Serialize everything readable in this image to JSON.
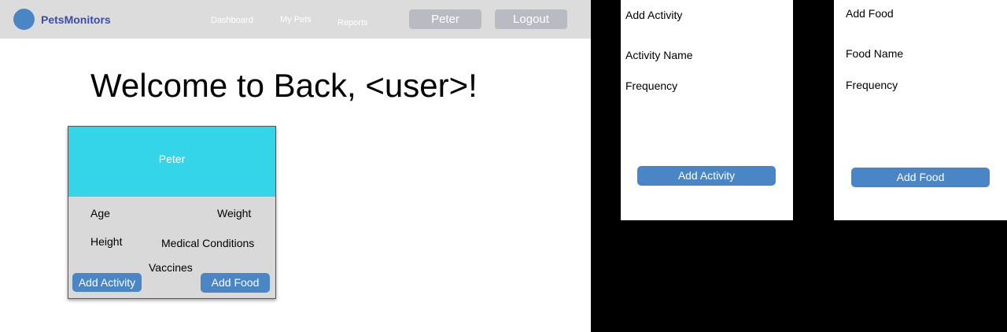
{
  "navbar": {
    "brand": "PetsMonitors",
    "links": [
      "Dashboard",
      "My Pets",
      "Reports"
    ],
    "user_button": "Peter",
    "logout_button": "Logout"
  },
  "main": {
    "welcome": "Welcome to Back, <user>!"
  },
  "pet_card": {
    "name": "Peter",
    "age_label": "Age",
    "weight_label": "Weight",
    "height_label": "Height",
    "medical_label": "Medical Conditions",
    "vaccines_label": "Vaccines",
    "add_activity_button": "Add Activity",
    "add_food_button": "Add Food"
  },
  "activity_panel": {
    "title": "Add Activity",
    "name_label": "Activity Name",
    "frequency_label": "Frequency",
    "submit_button": "Add Activity"
  },
  "food_panel": {
    "title": "Add Food",
    "name_label": "Food Name",
    "frequency_label": "Frequency",
    "submit_button": "Add Food"
  },
  "colors": {
    "accent": "#4a86c5",
    "card_header": "#34d5e8",
    "brand_text": "#3b4bb0"
  }
}
